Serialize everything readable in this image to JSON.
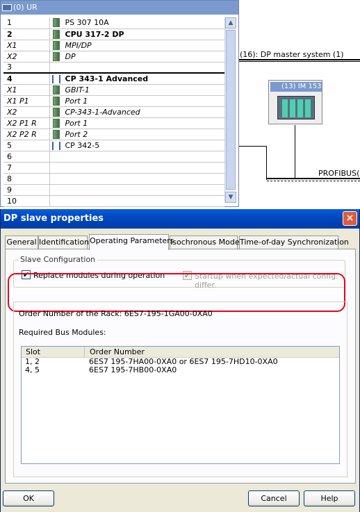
{
  "rack_window": {
    "title": "(0) UR",
    "rows": [
      {
        "slot": "1",
        "module": "PS 307 10A",
        "style": "normal",
        "icon": "module-icon"
      },
      {
        "slot": "2",
        "module": "CPU 317-2 DP",
        "style": "bold",
        "icon": "module-icon"
      },
      {
        "slot": "X1",
        "module": "MPI/DP",
        "style": "italic",
        "icon": "module-icon"
      },
      {
        "slot": "X2",
        "module": "DP",
        "style": "italic",
        "icon": "module-icon"
      },
      {
        "slot": "3",
        "module": "",
        "style": "separator",
        "icon": ""
      },
      {
        "slot": "4",
        "module": "CP 343-1 Advanced",
        "style": "bold",
        "icon": "network-icon"
      },
      {
        "slot": "X1",
        "module": "GBIT-1",
        "style": "italic",
        "icon": "module-icon"
      },
      {
        "slot": "X1 P1",
        "module": "Port 1",
        "style": "italic",
        "icon": "module-icon"
      },
      {
        "slot": "X2",
        "module": "CP-343-1-Advanced",
        "style": "italic",
        "icon": "module-icon"
      },
      {
        "slot": "X2 P1 R",
        "module": "Port 1",
        "style": "italic",
        "icon": "module-icon"
      },
      {
        "slot": "X2 P2 R",
        "module": "Port 2",
        "style": "italic",
        "icon": "module-icon"
      },
      {
        "slot": "5",
        "module": "CP 342-5",
        "style": "normal",
        "icon": "network-icon"
      },
      {
        "slot": "6",
        "module": "",
        "style": "normal",
        "icon": ""
      },
      {
        "slot": "7",
        "module": "",
        "style": "normal",
        "icon": ""
      },
      {
        "slot": "8",
        "module": "",
        "style": "normal",
        "icon": ""
      },
      {
        "slot": "9",
        "module": "",
        "style": "normal",
        "icon": ""
      },
      {
        "slot": "10",
        "module": "",
        "style": "normal",
        "icon": ""
      }
    ]
  },
  "network": {
    "dp_master_label": "(16): DP master system (1)",
    "im153_label": "(13) IM 153",
    "profibus_label": "PROFIBUS("
  },
  "dialog": {
    "title": "DP slave properties",
    "close_icon": "×",
    "tabs": [
      {
        "label": "General",
        "active": false
      },
      {
        "label": "Identification",
        "active": false
      },
      {
        "label": "Operating Parameters",
        "active": true
      },
      {
        "label": "Isochronous Mode",
        "active": false
      },
      {
        "label": "Time-of-day Synchronization",
        "active": false
      }
    ],
    "slave_configuration": {
      "legend": "Slave Configuration",
      "replace_modules": {
        "label": "Replace modules during operation",
        "checked": true,
        "enabled": true
      },
      "startup_expected": {
        "label": "Startup when expected/actual config. differ.",
        "checked": true,
        "enabled": false
      }
    },
    "rack_info": {
      "order_number_line": "Order Number of the Rack: 6ES7-195-1GA00-0XA0",
      "required_bus_modules_label": "Required Bus Modules:",
      "columns": {
        "slot": "Slot",
        "order_number": "Order Number"
      },
      "rows": [
        {
          "slot": "1, 2",
          "order_number": "6ES7 195-7HA00-0XA0 or 6ES7 195-7HD10-0XA0"
        },
        {
          "slot": "4, 5",
          "order_number": "6ES7 195-7HB00-0XA0"
        }
      ]
    },
    "buttons": {
      "ok": "OK",
      "cancel": "Cancel",
      "help": "Help"
    }
  },
  "colors": {
    "highlight": "#e8001c",
    "titlebar": "#0048c0",
    "dialog_bg": "#ece9d8"
  }
}
